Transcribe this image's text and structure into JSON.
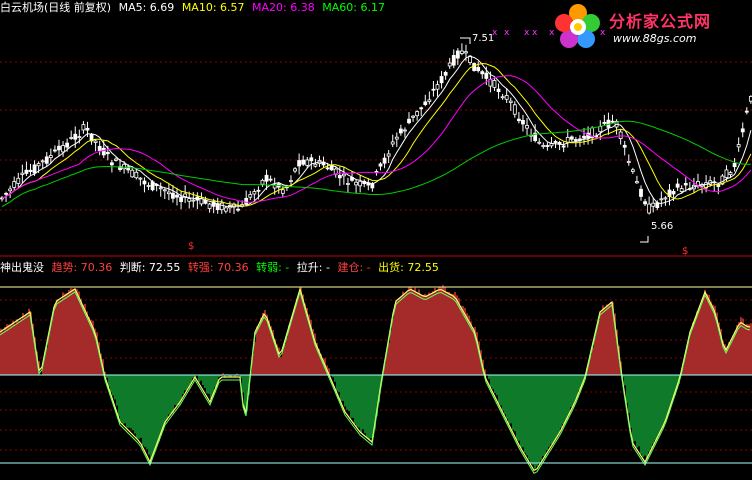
{
  "upper": {
    "title": "白云机场(日线 前复权)",
    "ma5": "MA5: 6.69",
    "ma10": "MA10: 6.57",
    "ma20": "MA20: 6.38",
    "ma60": "MA60: 6.17",
    "high_label": "7.51",
    "low_label": "5.66",
    "markers": [
      "x",
      "x",
      "x",
      "x",
      "x",
      "x",
      "x"
    ],
    "signal_marks": [
      "$",
      "$"
    ]
  },
  "lower": {
    "name": "神出鬼没",
    "trend": "趋势: 70.36",
    "judge": "判断: 72.55",
    "strong": "转强: 70.36",
    "weak": "转弱: -",
    "pull": "拉升: -",
    "build": "建仓: -",
    "ship": "出货: 72.55"
  },
  "logo": {
    "title": "分析家公式网",
    "url": "www.88gs.com"
  },
  "colors": {
    "background": "#000000",
    "up_candle": "#ffffff",
    "ma5": "#ffffff",
    "ma10": "#ffff00",
    "ma20": "#ff00ff",
    "ma60": "#00cc00",
    "red_fill": "#a52a2a",
    "green_fill": "#0f7a2a",
    "grid": "#8b0000",
    "title_text": "#ffffff",
    "red_text": "#ff4040",
    "green_text": "#00ff00",
    "yellow_text": "#ffff00"
  }
}
